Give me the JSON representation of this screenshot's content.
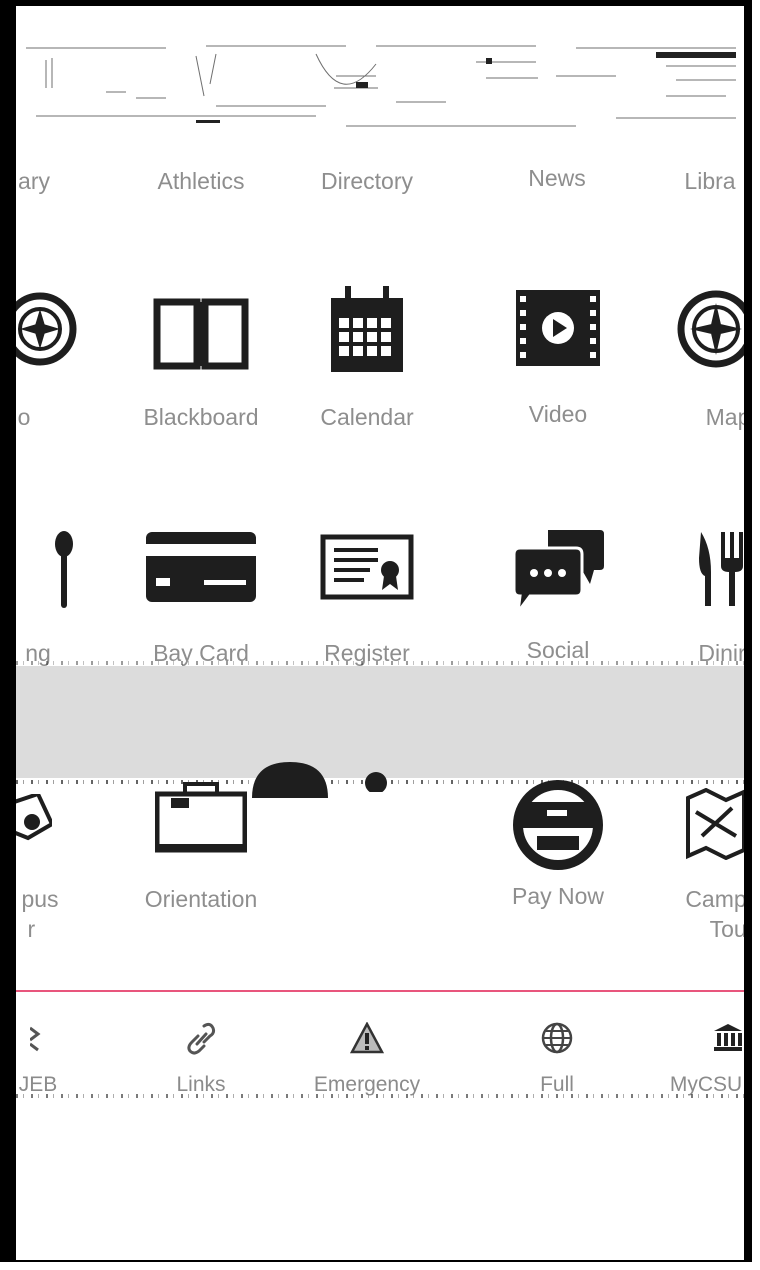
{
  "grid": {
    "row1": [
      "ary",
      "Athletics",
      "Directory",
      "News",
      "Libra"
    ],
    "row2": [
      "o",
      "Blackboard",
      "Calendar",
      "Video",
      "Map"
    ],
    "row3": [
      "ng",
      "Bay Card",
      "Register",
      "Social",
      "Dinir"
    ],
    "row4": [
      {
        "line1": "pus",
        "line2": "r"
      },
      {
        "line1": "Orientation",
        "line2": ""
      },
      {
        "line1": "",
        "line2": ""
      },
      {
        "line1": "Pay Now",
        "line2": ""
      },
      {
        "line1": "Camp",
        "line2": "Tou"
      }
    ]
  },
  "tabbar": {
    "items": [
      "JEB",
      "Links",
      "Emergency",
      "Full",
      "MyCSU"
    ]
  },
  "colors": {
    "accent_line": "#e8557c",
    "label_grey": "#8e8e8e",
    "icon_dark": "#1e1e1e",
    "band_grey": "#dcdcdc"
  },
  "icons": {
    "row2": [
      "compass-icon",
      "book-icon",
      "calendar-icon",
      "video-icon",
      "map-compass-icon"
    ],
    "row3": [
      "spoon-icon",
      "credit-card-icon",
      "certificate-icon",
      "chat-bubbles-icon",
      "fork-knife-icon"
    ],
    "row4": [
      "campus-tour-icon",
      "briefcase-icon",
      "person-icon",
      "payment-icon",
      "map-icon"
    ],
    "tabbar": [
      "chevron-icon",
      "link-icon",
      "warning-icon",
      "globe-icon",
      "institution-icon"
    ]
  }
}
